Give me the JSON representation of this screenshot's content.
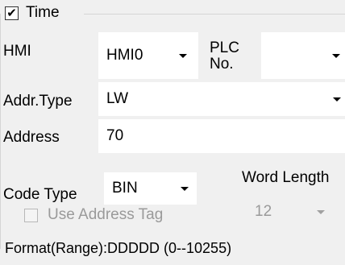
{
  "group": {
    "title": "Time",
    "checked": true
  },
  "hmi": {
    "label": "HMI",
    "value": "HMI0"
  },
  "plc": {
    "label_line1": "PLC",
    "label_line2": "No.",
    "value": ""
  },
  "addr_type": {
    "label": "Addr.Type",
    "value": "LW"
  },
  "address": {
    "label": "Address",
    "value": "70"
  },
  "code_type": {
    "label": "Code Type",
    "value": "BIN"
  },
  "word_length": {
    "label": "Word Length",
    "value": "12"
  },
  "use_address_tag": {
    "label": "Use Address Tag",
    "checked": false,
    "enabled": false
  },
  "format": {
    "text": "Format(Range):DDDDD (0--10255)"
  },
  "colors": {
    "background": "#f0f0f0",
    "field": "#ffffff",
    "disabled_text": "#9a9a9a"
  }
}
